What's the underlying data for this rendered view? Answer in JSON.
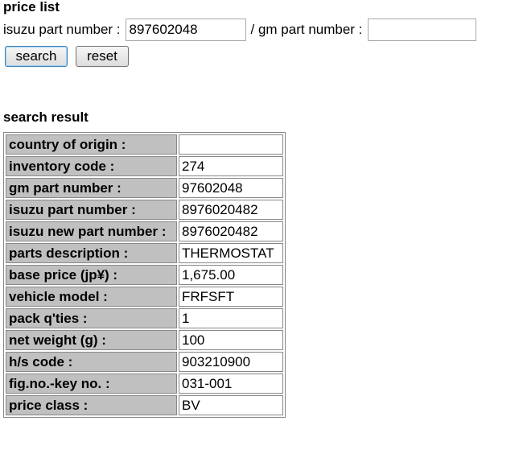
{
  "page_title": "price list",
  "search_form": {
    "isuzu_label": "isuzu part number :",
    "isuzu_value": "897602048",
    "gm_label": "/ gm part number :",
    "gm_value": "",
    "search_button": "search",
    "reset_button": "reset"
  },
  "result_heading": "search result",
  "result_rows": [
    {
      "key": "country of origin :",
      "value": ""
    },
    {
      "key": "inventory code :",
      "value": "274"
    },
    {
      "key": "gm part number :",
      "value": "97602048"
    },
    {
      "key": "isuzu part number :",
      "value": "8976020482"
    },
    {
      "key": "isuzu new part number :",
      "value": "8976020482"
    },
    {
      "key": "parts description :",
      "value": "THERMOSTAT"
    },
    {
      "key": "base price (jp¥) :",
      "value": "1,675.00"
    },
    {
      "key": "vehicle model :",
      "value": "FRFSFT"
    },
    {
      "key": "pack q'ties :",
      "value": "1"
    },
    {
      "key": "net weight (g) :",
      "value": "100"
    },
    {
      "key": "h/s code :",
      "value": "903210900"
    },
    {
      "key": "fig.no.-key no. :",
      "value": "031-001"
    },
    {
      "key": "price class :",
      "value": "BV"
    }
  ],
  "colors": {
    "key_cell_bg": "#c0c0c0",
    "border": "#888888",
    "search_button_focus": "#3c7fb1"
  }
}
